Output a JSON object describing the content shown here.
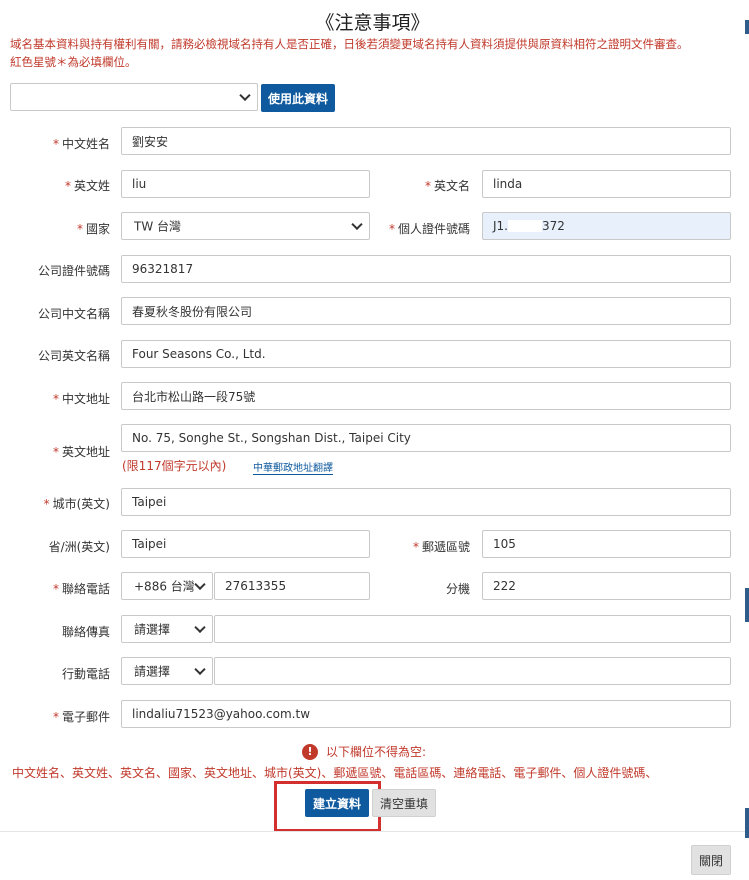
{
  "dialog": {
    "title": "《注意事項》",
    "notice_line1": "域名基本資料與持有權利有關，請務必檢視域名持有人是否正確，日後若須變更域名持有人資料須提供與原資料相符之證明文件審查。",
    "notice_line2": "紅色星號＊為必填欄位。"
  },
  "profile_select": {
    "value": "",
    "button_label": "使用此資料"
  },
  "required_mark": "*",
  "fields": {
    "cname": {
      "label": "中文姓名",
      "value": "劉安安"
    },
    "last_name_en": {
      "label": "英文姓",
      "value": "liu"
    },
    "first_name_en": {
      "label": "英文名",
      "value": "linda"
    },
    "country": {
      "label": "國家",
      "value": "TW 台灣"
    },
    "id_number": {
      "label": "個人證件號碼",
      "value_prefix": "J1.",
      "value_suffix": "372"
    },
    "company_id": {
      "label": "公司證件號碼",
      "value": "96321817"
    },
    "company_cname": {
      "label": "公司中文名稱",
      "value": "春夏秋冬股份有限公司"
    },
    "company_ename": {
      "label": "公司英文名稱",
      "value": "Four Seasons Co., Ltd."
    },
    "address_cn": {
      "label": "中文地址",
      "value": "台北市松山路一段75號"
    },
    "address_en": {
      "label": "英文地址",
      "value": "No. 75, Songhe St., Songshan Dist., Taipei City",
      "limit_hint": "(限117個字元以內)",
      "translate_link": "中華郵政地址翻譯"
    },
    "city": {
      "label": "城市(英文)",
      "value": "Taipei"
    },
    "state": {
      "label": "省/洲(英文)",
      "value": "Taipei"
    },
    "postal": {
      "label": "郵遞區號",
      "value": "105"
    },
    "phone": {
      "label": "聯絡電話",
      "code": "+886 台灣",
      "value": "27613355"
    },
    "ext": {
      "label": "分機",
      "value": "222"
    },
    "fax": {
      "label": "聯絡傳真",
      "code": "請選擇",
      "value": ""
    },
    "mobile": {
      "label": "行動電話",
      "code": "請選擇",
      "value": ""
    },
    "email": {
      "label": "電子郵件",
      "value": "lindaliu71523@yahoo.com.tw"
    }
  },
  "validation": {
    "icon": "!",
    "message": "以下欄位不得為空:",
    "fields_list": "中文姓名、英文姓、英文名、國家、英文地址、城市(英文)、郵遞區號、電話區碼、連絡電話、電子郵件、個人證件號碼、"
  },
  "actions": {
    "create": "建立資料",
    "reset": "清空重填",
    "close": "關閉"
  },
  "colors": {
    "primary": "#0f5a9e",
    "error": "#c0392b",
    "highlight_border": "#d32f2f",
    "autofill_bg": "#e8f0fc"
  }
}
